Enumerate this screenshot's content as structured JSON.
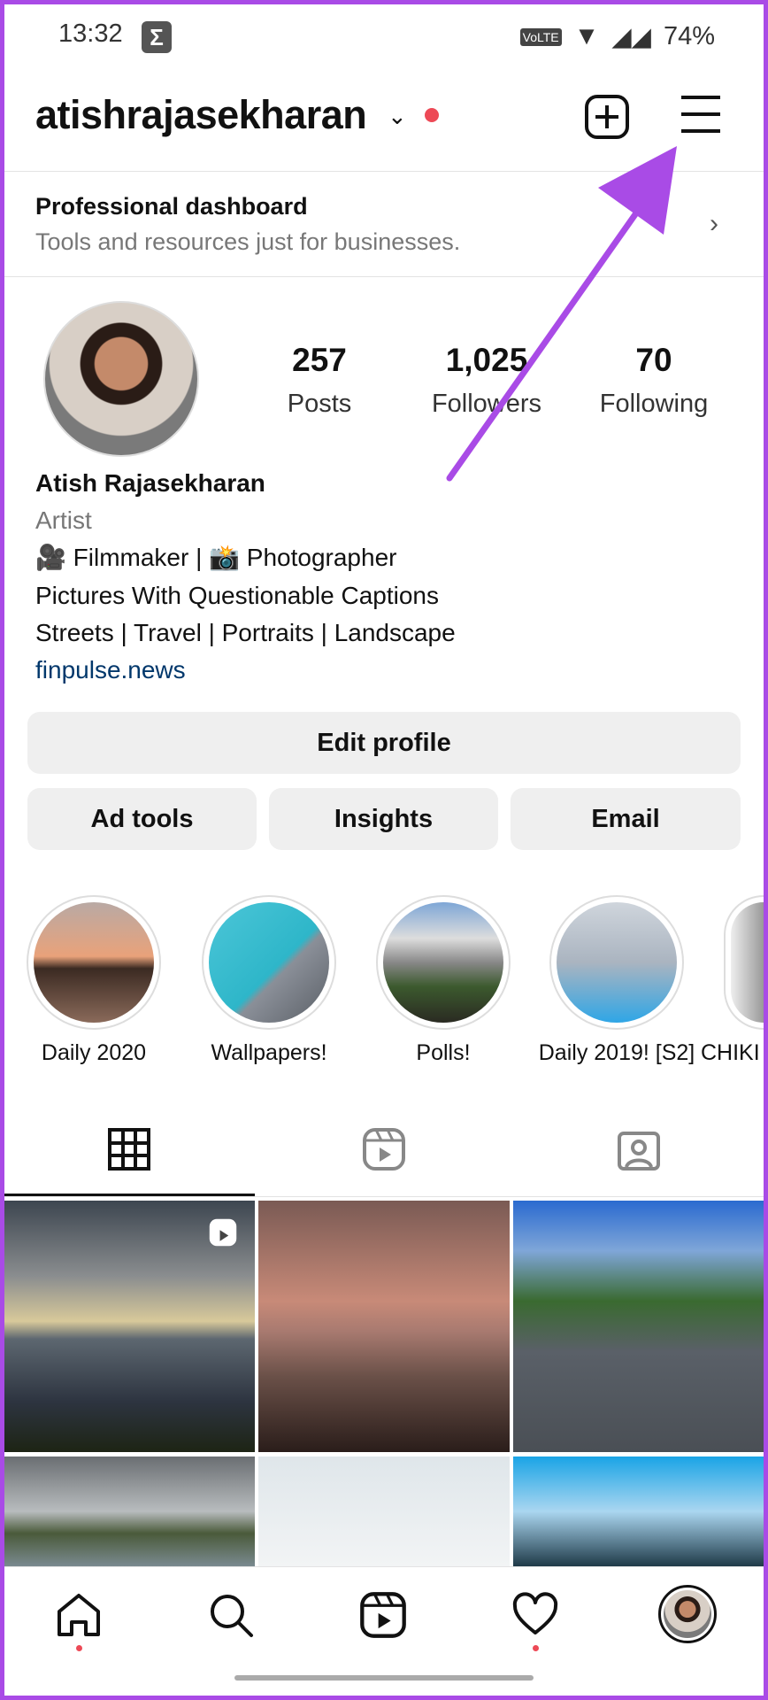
{
  "status_bar": {
    "time": "13:32",
    "notification_icon": "sigma-icon",
    "network": "VoLTE",
    "battery": "74%"
  },
  "header": {
    "username": "atishrajasekharan",
    "dropdown_icon": "chevron-down-icon",
    "notification_dot_color": "#ed4956",
    "create_icon": "plus-square-icon",
    "menu_icon": "hamburger-menu-icon"
  },
  "dashboard": {
    "title": "Professional dashboard",
    "subtitle": "Tools and resources just for businesses."
  },
  "profile": {
    "stats": [
      {
        "value": "257",
        "label": "Posts"
      },
      {
        "value": "1,025",
        "label": "Followers"
      },
      {
        "value": "70",
        "label": "Following"
      }
    ],
    "name": "Atish Rajasekharan",
    "category": "Artist",
    "bio": [
      "🎥 Filmmaker | 📸 Photographer",
      "Pictures With Questionable Captions",
      "Streets | Travel | Portraits | Landscape"
    ],
    "link": "finpulse.news"
  },
  "buttons": {
    "edit_profile": "Edit profile",
    "ad_tools": "Ad tools",
    "insights": "Insights",
    "email": "Email"
  },
  "highlights": [
    {
      "label": "Daily 2020"
    },
    {
      "label": "Wallpapers!"
    },
    {
      "label": "Polls!"
    },
    {
      "label": "Daily 2019! [S2]"
    },
    {
      "label": "CHIKI"
    }
  ],
  "tabs": [
    "grid-icon",
    "reels-icon",
    "tagged-icon"
  ],
  "bottom_nav": [
    "home-icon",
    "search-icon",
    "reels-icon",
    "heart-icon",
    "profile-avatar"
  ],
  "annotation_color": "#a94be6"
}
